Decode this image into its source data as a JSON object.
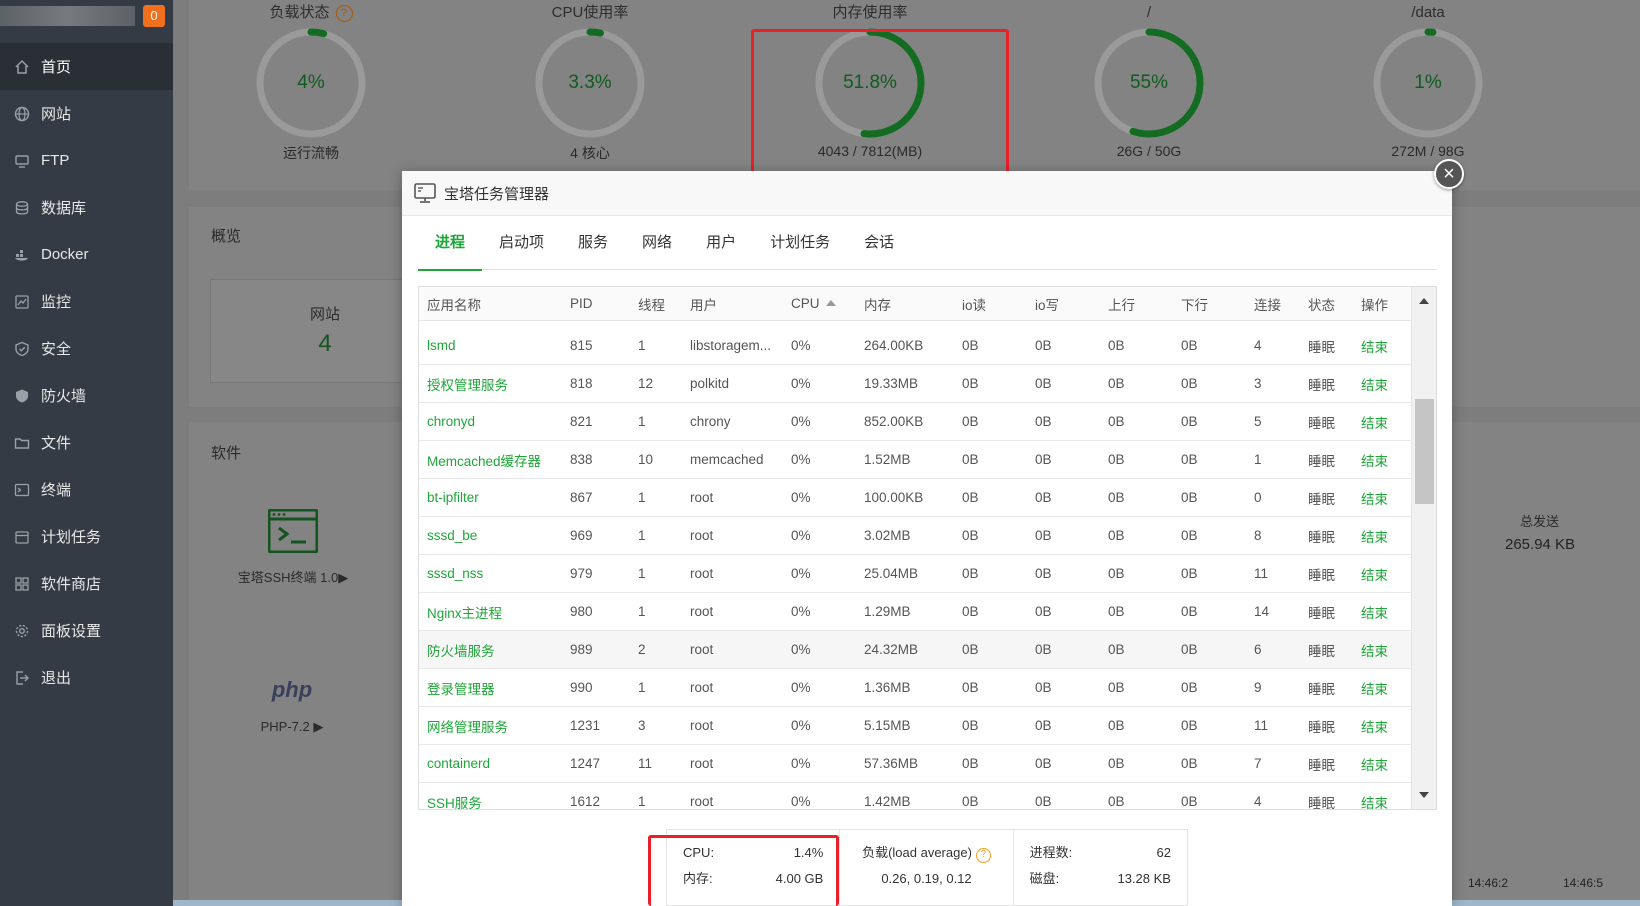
{
  "sidebar": {
    "badge": "0",
    "items": [
      {
        "label": "首页",
        "icon": "home-icon"
      },
      {
        "label": "网站",
        "icon": "globe-icon"
      },
      {
        "label": "FTP",
        "icon": "ftp-icon"
      },
      {
        "label": "数据库",
        "icon": "database-icon"
      },
      {
        "label": "Docker",
        "icon": "docker-icon"
      },
      {
        "label": "监控",
        "icon": "monitor-icon"
      },
      {
        "label": "安全",
        "icon": "shield-icon"
      },
      {
        "label": "防火墙",
        "icon": "firewall-icon"
      },
      {
        "label": "文件",
        "icon": "folder-icon"
      },
      {
        "label": "终端",
        "icon": "terminal-icon"
      },
      {
        "label": "计划任务",
        "icon": "calendar-icon"
      },
      {
        "label": "软件商店",
        "icon": "grid-icon"
      },
      {
        "label": "面板设置",
        "icon": "gear-icon"
      },
      {
        "label": "退出",
        "icon": "logout-icon"
      }
    ]
  },
  "gauges": [
    {
      "title": "负载状态",
      "value": "4%",
      "sub": "运行流畅",
      "percent": 4,
      "help": "?"
    },
    {
      "title": "CPU使用率",
      "value": "3.3%",
      "sub": "4 核心",
      "percent": 3.3
    },
    {
      "title": "内存使用率",
      "value": "51.8%",
      "sub": "4043 / 7812(MB)",
      "percent": 51.8
    },
    {
      "title": "/",
      "value": "55%",
      "sub": "26G / 50G",
      "percent": 55
    },
    {
      "title": "/data",
      "value": "1%",
      "sub": "272M / 98G",
      "percent": 1
    }
  ],
  "overview": {
    "title": "概览",
    "site_label": "网站",
    "site_count": "4"
  },
  "software": {
    "title": "软件",
    "ssh_label": "宝塔SSH终端 1.0▶",
    "php_logo": "php",
    "php_label": "PHP-7.2 ▶"
  },
  "traffic": {
    "label": "总发送",
    "value": "265.94 KB"
  },
  "times": [
    "14:46:2",
    "14:46:5"
  ],
  "dialog": {
    "title": "宝塔任务管理器",
    "tabs": [
      "进程",
      "启动项",
      "服务",
      "网络",
      "用户",
      "计划任务",
      "会话"
    ],
    "columns": [
      "应用名称",
      "PID",
      "线程",
      "用户",
      "CPU",
      "内存",
      "io读",
      "io写",
      "上行",
      "下行",
      "连接",
      "状态",
      "操作"
    ],
    "rows": [
      {
        "name": "lsmd",
        "pid": "815",
        "threads": "1",
        "user": "libstoragem...",
        "cpu": "0%",
        "mem": "264.00KB",
        "ior": "0B",
        "iow": "0B",
        "up": "0B",
        "down": "0B",
        "conn": "4",
        "state": "睡眠",
        "op": "结束"
      },
      {
        "name": "授权管理服务",
        "pid": "818",
        "threads": "12",
        "user": "polkitd",
        "cpu": "0%",
        "mem": "19.33MB",
        "ior": "0B",
        "iow": "0B",
        "up": "0B",
        "down": "0B",
        "conn": "3",
        "state": "睡眠",
        "op": "结束"
      },
      {
        "name": "chronyd",
        "pid": "821",
        "threads": "1",
        "user": "chrony",
        "cpu": "0%",
        "mem": "852.00KB",
        "ior": "0B",
        "iow": "0B",
        "up": "0B",
        "down": "0B",
        "conn": "5",
        "state": "睡眠",
        "op": "结束"
      },
      {
        "name": "Memcached缓存器",
        "pid": "838",
        "threads": "10",
        "user": "memcached",
        "cpu": "0%",
        "mem": "1.52MB",
        "ior": "0B",
        "iow": "0B",
        "up": "0B",
        "down": "0B",
        "conn": "1",
        "state": "睡眠",
        "op": "结束"
      },
      {
        "name": "bt-ipfilter",
        "pid": "867",
        "threads": "1",
        "user": "root",
        "cpu": "0%",
        "mem": "100.00KB",
        "ior": "0B",
        "iow": "0B",
        "up": "0B",
        "down": "0B",
        "conn": "0",
        "state": "睡眠",
        "op": "结束"
      },
      {
        "name": "sssd_be",
        "pid": "969",
        "threads": "1",
        "user": "root",
        "cpu": "0%",
        "mem": "3.02MB",
        "ior": "0B",
        "iow": "0B",
        "up": "0B",
        "down": "0B",
        "conn": "8",
        "state": "睡眠",
        "op": "结束"
      },
      {
        "name": "sssd_nss",
        "pid": "979",
        "threads": "1",
        "user": "root",
        "cpu": "0%",
        "mem": "25.04MB",
        "ior": "0B",
        "iow": "0B",
        "up": "0B",
        "down": "0B",
        "conn": "11",
        "state": "睡眠",
        "op": "结束"
      },
      {
        "name": "Nginx主进程",
        "pid": "980",
        "threads": "1",
        "user": "root",
        "cpu": "0%",
        "mem": "1.29MB",
        "ior": "0B",
        "iow": "0B",
        "up": "0B",
        "down": "0B",
        "conn": "14",
        "state": "睡眠",
        "op": "结束"
      },
      {
        "name": "防火墙服务",
        "pid": "989",
        "threads": "2",
        "user": "root",
        "cpu": "0%",
        "mem": "24.32MB",
        "ior": "0B",
        "iow": "0B",
        "up": "0B",
        "down": "0B",
        "conn": "6",
        "state": "睡眠",
        "op": "结束"
      },
      {
        "name": "登录管理器",
        "pid": "990",
        "threads": "1",
        "user": "root",
        "cpu": "0%",
        "mem": "1.36MB",
        "ior": "0B",
        "iow": "0B",
        "up": "0B",
        "down": "0B",
        "conn": "9",
        "state": "睡眠",
        "op": "结束"
      },
      {
        "name": "网络管理服务",
        "pid": "1231",
        "threads": "3",
        "user": "root",
        "cpu": "0%",
        "mem": "5.15MB",
        "ior": "0B",
        "iow": "0B",
        "up": "0B",
        "down": "0B",
        "conn": "11",
        "state": "睡眠",
        "op": "结束"
      },
      {
        "name": "containerd",
        "pid": "1247",
        "threads": "11",
        "user": "root",
        "cpu": "0%",
        "mem": "57.36MB",
        "ior": "0B",
        "iow": "0B",
        "up": "0B",
        "down": "0B",
        "conn": "7",
        "state": "睡眠",
        "op": "结束"
      },
      {
        "name": "SSH服务",
        "pid": "1612",
        "threads": "1",
        "user": "root",
        "cpu": "0%",
        "mem": "1.42MB",
        "ior": "0B",
        "iow": "0B",
        "up": "0B",
        "down": "0B",
        "conn": "4",
        "state": "睡眠",
        "op": "结束"
      }
    ],
    "summary": {
      "cpu_label": "CPU:",
      "cpu_value": "1.4%",
      "mem_label": "内存:",
      "mem_value": "4.00 GB",
      "load_label": "负载(load average)",
      "load_help": "?",
      "load_value": "0.26, 0.19, 0.12",
      "proc_label": "进程数:",
      "proc_value": "62",
      "disk_label": "磁盘:",
      "disk_value": "13.28 KB"
    }
  },
  "colors": {
    "accent": "#20a53a",
    "highlight": "#e8202a",
    "sidebar": "#353b44"
  }
}
